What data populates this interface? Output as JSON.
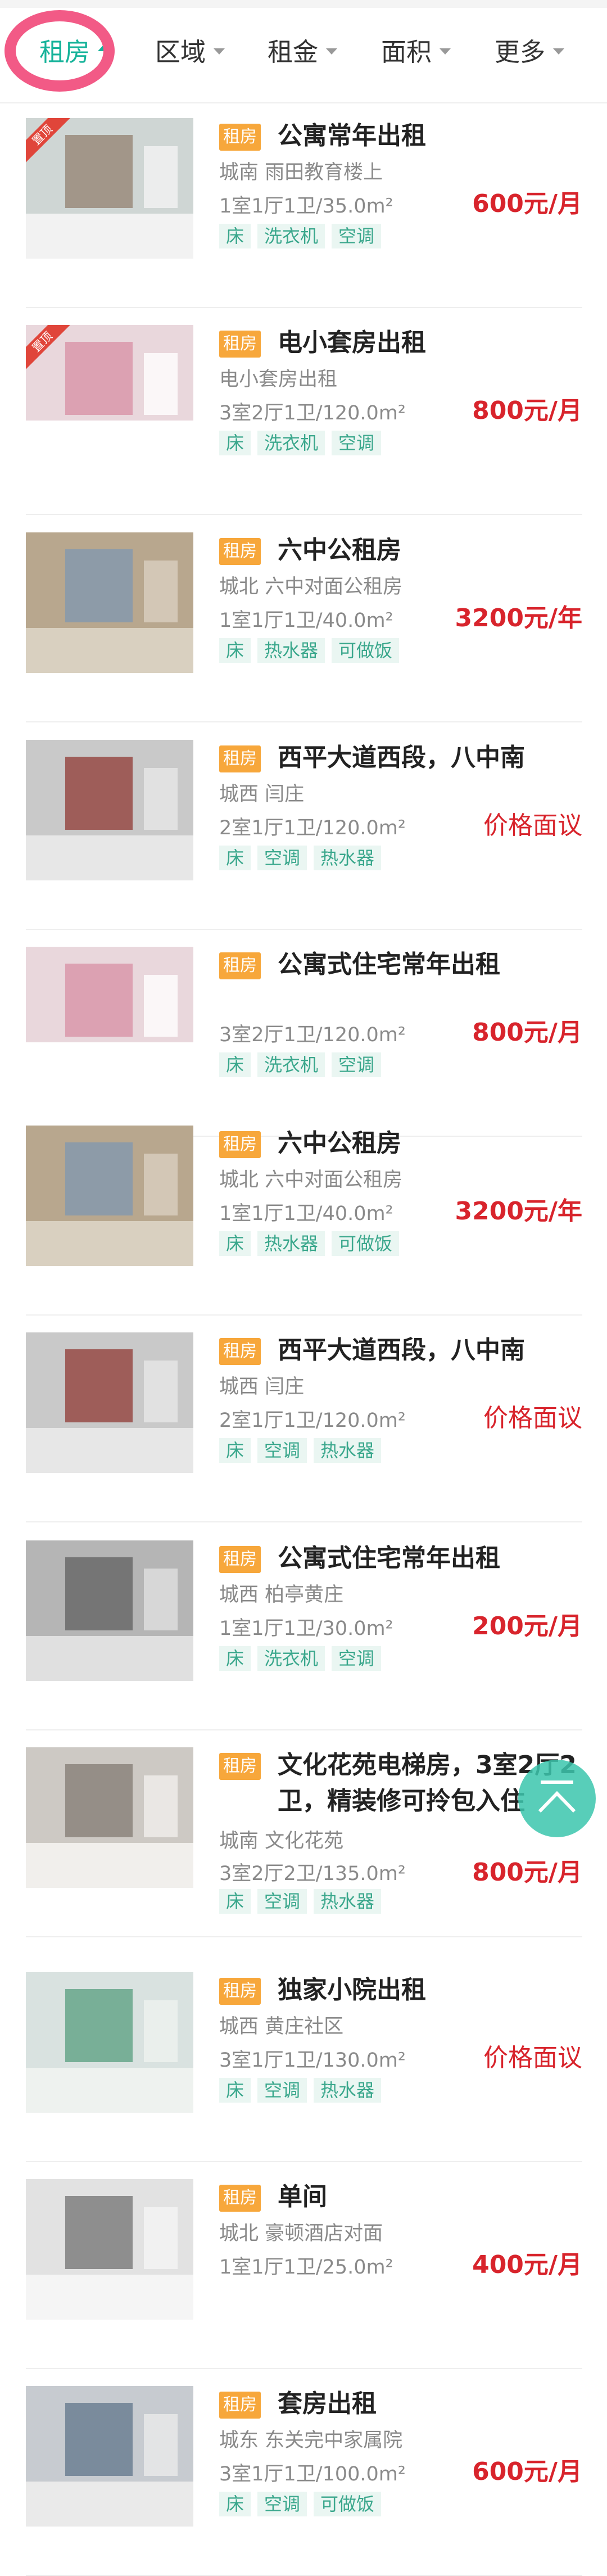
{
  "filters": [
    {
      "label": "租房",
      "active": true
    },
    {
      "label": "区域",
      "active": false
    },
    {
      "label": "租金",
      "active": false
    },
    {
      "label": "面积",
      "active": false
    },
    {
      "label": "更多",
      "active": false
    }
  ],
  "listings": [
    {
      "tag": "租房",
      "title": "公寓常年出租",
      "location": "城南 雨田教育楼上",
      "spec": "1室1厅1卫/35.0m²",
      "price": "600元/月",
      "features": [
        "床",
        "洗衣机",
        "空调"
      ],
      "pinned": "置顶"
    },
    {
      "tag": "租房",
      "title": "电小套房出租",
      "location": "电小套房出租",
      "spec": "3室2厅1卫/120.0m²",
      "price": "800元/月",
      "features": [
        "床",
        "洗衣机",
        "空调"
      ],
      "pinned": "置顶"
    },
    {
      "tag": "租房",
      "title": "六中公租房",
      "location": "城北 六中对面公租房",
      "spec": "1室1厅1卫/40.0m²",
      "price": "3200元/年",
      "features": [
        "床",
        "热水器",
        "可做饭"
      ]
    },
    {
      "tag": "租房",
      "title": "西平大道西段，八中南",
      "location": "城西 闫庄",
      "spec": "2室1厅1卫/120.0m²",
      "price": "价格面议",
      "features": [
        "床",
        "空调",
        "热水器"
      ]
    },
    {
      "tag": "租房",
      "title": "公寓式住宅常年出租",
      "location": "",
      "spec": "3室2厅1卫/120.0m²",
      "price": "800元/月",
      "features": [
        "床",
        "洗衣机",
        "空调"
      ]
    },
    {
      "tag": "租房",
      "title": "六中公租房",
      "location": "城北 六中对面公租房",
      "spec": "1室1厅1卫/40.0m²",
      "price": "3200元/年",
      "features": [
        "床",
        "热水器",
        "可做饭"
      ]
    },
    {
      "tag": "租房",
      "title": "西平大道西段，八中南",
      "location": "城西 闫庄",
      "spec": "2室1厅1卫/120.0m²",
      "price": "价格面议",
      "features": [
        "床",
        "空调",
        "热水器"
      ]
    },
    {
      "tag": "租房",
      "title": "公寓式住宅常年出租",
      "location": "城西 柏亭黄庄",
      "spec": "1室1厅1卫/30.0m²",
      "price": "200元/月",
      "features": [
        "床",
        "洗衣机",
        "空调"
      ]
    },
    {
      "tag": "租房",
      "title": "文化花苑电梯房，3室2厅2卫，精装修可拎包入住",
      "location": "城南 文化花苑",
      "spec": "3室2厅2卫/135.0m²",
      "price": "800元/月",
      "features": [
        "床",
        "空调",
        "热水器"
      ]
    },
    {
      "tag": "租房",
      "title": "独家小院出租",
      "location": "城西 黄庄社区",
      "spec": "3室1厅1卫/130.0m²",
      "price": "价格面议",
      "features": [
        "床",
        "空调",
        "热水器"
      ]
    },
    {
      "tag": "租房",
      "title": "单间",
      "location": "城北 豪顿酒店对面",
      "spec": "1室1厅1卫/25.0m²",
      "price": "400元/月",
      "features": []
    },
    {
      "tag": "租房",
      "title": "套房出租",
      "location": "城东 东关完中家属院",
      "spec": "3室1厅1卫/100.0m²",
      "price": "600元/月",
      "features": [
        "床",
        "空调",
        "可做饭"
      ]
    }
  ],
  "colors": {
    "accent": "#16b39a",
    "price": "#d8242c",
    "tag": "#f7a73b",
    "highlight": "#f25a86"
  },
  "icons": {
    "back_to_top": "arrow-up-icon",
    "filter_caret": "caret-down-icon"
  }
}
